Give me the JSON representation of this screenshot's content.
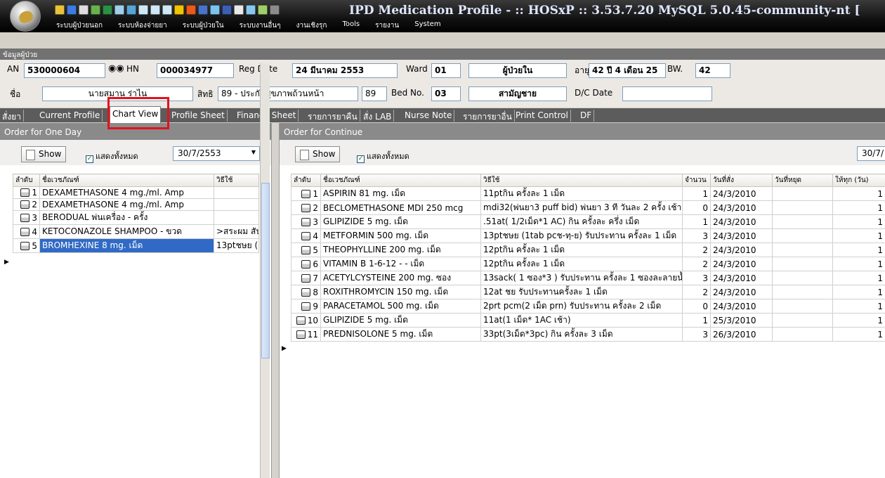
{
  "window": {
    "title": "IPD Medication Profile - :: HOSxP :: 3.53.7.20 MySQL 5.0.45-community-nt ["
  },
  "menu": [
    "ระบบผู้ป่วยนอก",
    "ระบบห้องจ่ายยา",
    "ระบบผู้ป่วยใน",
    "ระบบงานอื่นๆ",
    "งานเชิงรุก",
    "Tools",
    "รายงาน",
    "System"
  ],
  "patient_panel": {
    "header": "ข้อมูลผู้ป่วย",
    "an_label": "AN",
    "an": "530000604",
    "hn_label": "HN",
    "hn": "000034977",
    "regdate_label": "Reg Date",
    "regdate": "24 มีนาคม 2553",
    "ward_label": "Ward",
    "ward": "01",
    "type": "ผู้ป่วยใน",
    "age_label": "อายุ",
    "age": "42 ปี 4 เดือน 25",
    "bw_label": "BW.",
    "bw": "42",
    "name_label": "ชื่อ",
    "name": "นายสมาน ร่าไน",
    "right_label": "สิทธิ",
    "right": "89 - ประกันสุขภาพถ้วนหน้า",
    "right_code": "89",
    "bed_label": "Bed No.",
    "bed": "03",
    "ward_name": "สามัญชาย",
    "dc_label": "D/C Date",
    "dc": ""
  },
  "tabs": [
    "สั่งยา",
    "Current Profile",
    "Chart View",
    "Profile Sheet",
    "Finance Sheet",
    "รายการยาคืน",
    "สั่ง LAB",
    "Nurse Note",
    "รายการยาอื่น",
    "Print Control",
    "DF"
  ],
  "left_pane": {
    "title": "Order for One Day",
    "show": "Show",
    "show_all": "แสดงทั้งหมด",
    "date": "30/7/2553",
    "headers": {
      "seq": "ลำดับ",
      "name": "ชื่อเวชภัณฑ์",
      "usage": "วิธีใช้"
    },
    "rows": [
      {
        "seq": "1",
        "name": "DEXAMETHASONE 4 mg./ml. Amp",
        "usage": ""
      },
      {
        "seq": "2",
        "name": "DEXAMETHASONE 4 mg./ml. Amp",
        "usage": ""
      },
      {
        "seq": "3",
        "name": "BERODUAL พ่นเครื่อง - ครั้ง",
        "usage": ""
      },
      {
        "seq": "4",
        "name": "KETOCONAZOLE SHAMPOO - ขวด",
        "usage": ">สระผม สัป"
      },
      {
        "seq": "5",
        "name": "BROMHEXINE 8 mg. เม็ด",
        "usage": "13ptชษย ("
      }
    ]
  },
  "right_pane": {
    "title": "Order for Continue",
    "show": "Show",
    "show_all": "แสดงทั้งหมด",
    "date": "30/7/",
    "headers": {
      "seq": "ลำดับ",
      "name": "ชื่อเวชภัณฑ์",
      "usage": "วิธีใช้",
      "qty": "จำนวน",
      "start": "วันที่สั่ง",
      "stop": "วันที่หยุด",
      "every": "ให้ทุก (วัน)"
    },
    "rows": [
      {
        "seq": "1",
        "name": "ASPIRIN 81 mg. เม็ด",
        "usage": "11ptกิน ครั้งละ 1 เม็ด",
        "qty": "1",
        "start": "24/3/2010",
        "stop": "",
        "every": "1"
      },
      {
        "seq": "2",
        "name": "BECLOMETHASONE MDI 250 mcg",
        "usage": "mdi32(พ่นยา3 puff bid) พ่นยา 3 ที วันละ 2 ครั้ง เช้า -",
        "qty": "0",
        "start": "24/3/2010",
        "stop": "",
        "every": "1"
      },
      {
        "seq": "3",
        "name": "GLIPIZIDE 5 mg. เม็ด",
        "usage": ".51at( 1/2เม็ด*1 AC) กิน ครั้งละ ครึ่ง เม็ด",
        "qty": "1",
        "start": "24/3/2010",
        "stop": "",
        "every": "1"
      },
      {
        "seq": "4",
        "name": "METFORMIN 500 mg. เม็ด",
        "usage": "13ptชษย (1tab pcช-ทฺ-ย) รับประทาน ครั้งละ 1 เม็ด",
        "qty": "3",
        "start": "24/3/2010",
        "stop": "",
        "every": "1"
      },
      {
        "seq": "5",
        "name": "THEOPHYLLINE 200 mg. เม็ด",
        "usage": "12ptกิน ครั้งละ 1 เม็ด",
        "qty": "2",
        "start": "24/3/2010",
        "stop": "",
        "every": "1"
      },
      {
        "seq": "6",
        "name": "VITAMIN B 1-6-12 - - เม็ด",
        "usage": "12ptกิน ครั้งละ 1 เม็ด",
        "qty": "2",
        "start": "24/3/2010",
        "stop": "",
        "every": "1"
      },
      {
        "seq": "7",
        "name": "ACETYLCYSTEINE 200 mg. ซอง",
        "usage": "13sack( 1 ซอง*3 ) รับประทาน ครั้งละ 1 ซองละลายน้ำ",
        "qty": "3",
        "start": "24/3/2010",
        "stop": "",
        "every": "1"
      },
      {
        "seq": "8",
        "name": "ROXITHROMYCIN 150 mg. เม็ด",
        "usage": "12at ชย รับประทานครั้งละ 1 เม็ด",
        "qty": "2",
        "start": "24/3/2010",
        "stop": "",
        "every": "1"
      },
      {
        "seq": "9",
        "name": "PARACETAMOL 500 mg. เม็ด",
        "usage": "2prt pcm(2 เม็ด prn) รับประทาน ครั้งละ 2 เม็ด",
        "qty": "0",
        "start": "24/3/2010",
        "stop": "",
        "every": "1"
      },
      {
        "seq": "10",
        "name": "GLIPIZIDE 5 mg. เม็ด",
        "usage": "11at(1 เม็ด* 1AC เช้า)",
        "qty": "1",
        "start": "25/3/2010",
        "stop": "",
        "every": "1"
      },
      {
        "seq": "11",
        "name": "PREDNISOLONE 5 mg. เม็ด",
        "usage": "33pt(3เม็ด*3pc) กิน ครั้งละ 3 เม็ด",
        "qty": "3",
        "start": "26/3/2010",
        "stop": "",
        "every": "1"
      }
    ]
  }
}
